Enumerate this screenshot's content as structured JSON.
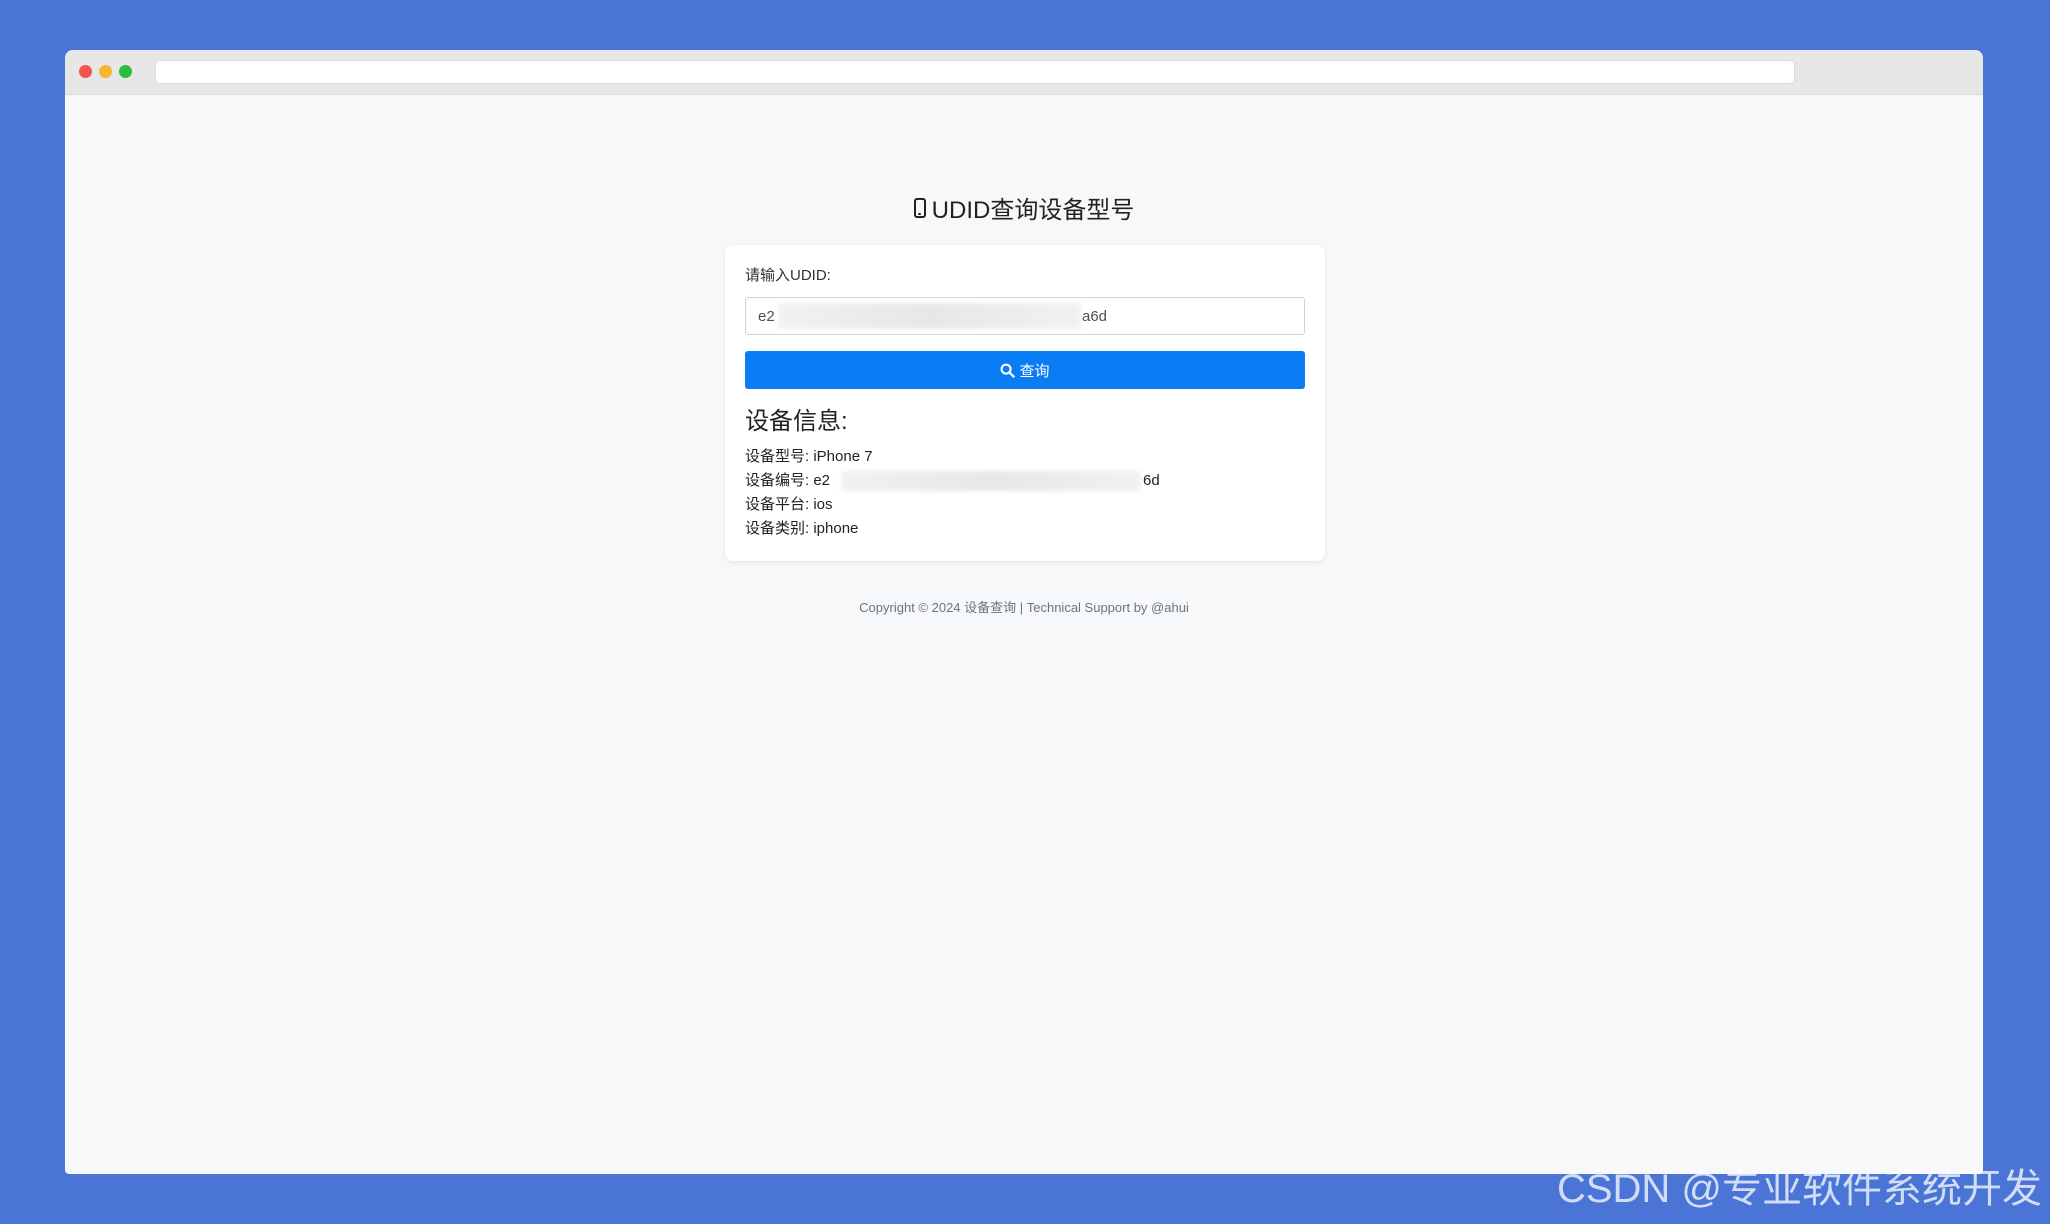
{
  "browser": {
    "address_bar_value": ""
  },
  "page": {
    "title": "UDID查询设备型号",
    "title_icon": "mobile-phone-icon"
  },
  "form": {
    "label": "请输入UDID:",
    "udid_value": "e2",
    "udid_value_end": "a6d",
    "query_button_label": "查询",
    "query_button_icon": "search-icon",
    "button_color": "#0a7cf4"
  },
  "device_info": {
    "heading": "设备信息:",
    "rows": [
      {
        "label": "设备型号:",
        "value": "iPhone 7"
      },
      {
        "label": "设备编号:",
        "value": "e2",
        "value_end": "6d"
      },
      {
        "label": "设备平台:",
        "value": "ios"
      },
      {
        "label": "设备类别:",
        "value": "iphone"
      }
    ]
  },
  "footer": {
    "text": "Copyright © 2024 设备查询 | Technical Support by @ahui"
  },
  "watermark": {
    "text": "CSDN @专业软件系统开发"
  },
  "colors": {
    "background": "#4a75d6",
    "page_background": "#f7f8fa"
  }
}
